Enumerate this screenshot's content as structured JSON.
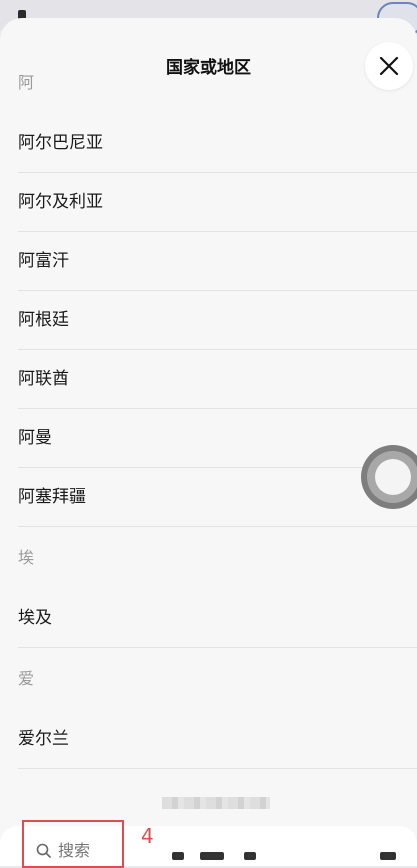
{
  "header": {
    "title": "国家或地区"
  },
  "sections": [
    {
      "letter": "阿",
      "items": [
        "阿尔巴尼亚",
        "阿尔及利亚",
        "阿富汗",
        "阿根廷",
        "阿联酋",
        "阿曼",
        "阿塞拜疆"
      ]
    },
    {
      "letter": "埃",
      "items": [
        "埃及"
      ]
    },
    {
      "letter": "爱",
      "items": [
        "爱尔兰"
      ]
    }
  ],
  "search": {
    "placeholder": "搜索"
  },
  "annotation": {
    "label": "4"
  },
  "colors": {
    "annotation": "#e24b4b",
    "sheet_bg": "#f7f7f7",
    "divider": "#e3e3e3"
  },
  "icons": {
    "close": "close-icon",
    "search": "search-icon",
    "assistive_touch": "floating-ball-icon"
  }
}
